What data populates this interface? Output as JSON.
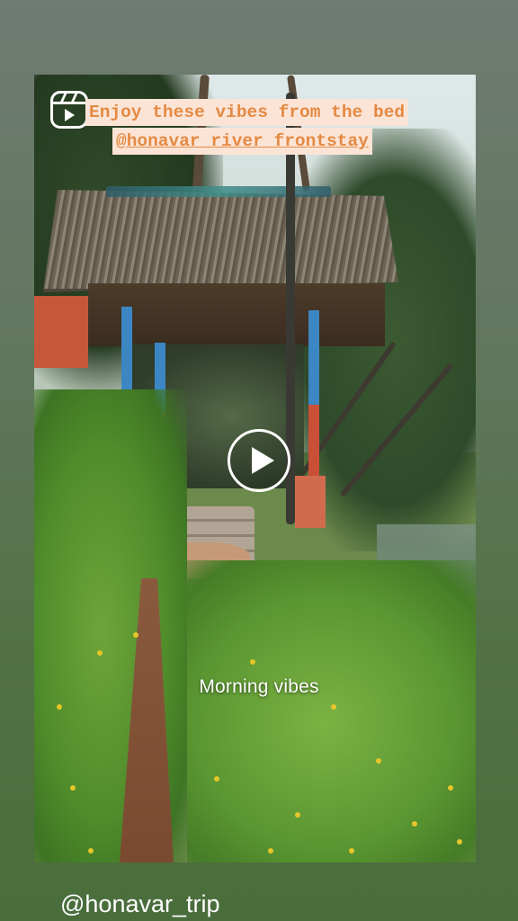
{
  "story": {
    "caption_line1": "Enjoy these vibes from the bed",
    "caption_line2": "@honavar_river_frontstay",
    "overlay_text": "Morning vibes",
    "mention": "@honavar_trip"
  },
  "icons": {
    "reels": "reels-icon",
    "play": "play-icon"
  },
  "colors": {
    "caption_bg": "#fbe4d6",
    "caption_text": "#e48a43",
    "background_top": "#6f7b73",
    "background_bottom": "#4a6d3c"
  }
}
